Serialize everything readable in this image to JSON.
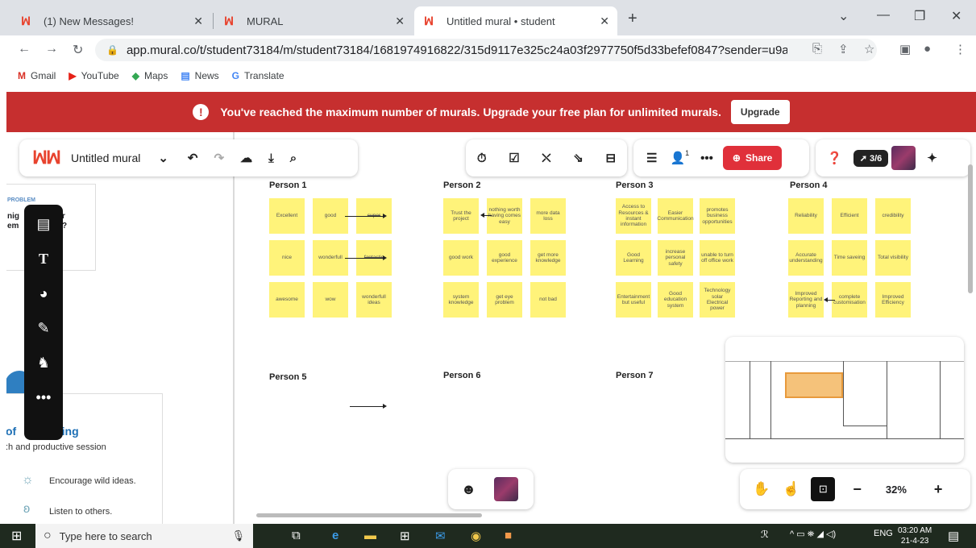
{
  "browser": {
    "tabs": [
      {
        "title": "(1) New Messages!"
      },
      {
        "title": "MURAL"
      },
      {
        "title": "Untitled mural • student"
      }
    ],
    "url": "app.mural.co/t/student73184/m/student73184/1681974916822/315d9117e325c24a03f2977750f5d33befef0847?sender=u9a012a...",
    "bookmarks": [
      "Gmail",
      "YouTube",
      "Maps",
      "News",
      "Translate"
    ]
  },
  "banner": {
    "message": "You've reached the maximum number of murals. Upgrade your free plan for unlimited murals.",
    "button": "Upgrade"
  },
  "mural": {
    "title": "Untitled mural",
    "share_label": "Share",
    "collab_count": "3/6",
    "notification_count": "1",
    "zoom": "32%"
  },
  "left_panel": {
    "problem_label": "PROBLEM",
    "partial_line1": "nig",
    "partial_line2": "em",
    "partial_tail1": "r",
    "partial_tail2": "?",
    "brainstorm_prefix": "of",
    "brainstorm_title": "orming",
    "brainstorm_sub": ":h and productive session",
    "tips": [
      "Encourage wild ideas.",
      "Listen to others."
    ]
  },
  "persons": [
    {
      "name": "Person 1",
      "notes": [
        [
          "Excellent",
          "good",
          "super"
        ],
        [
          "nice",
          "wonderfull",
          "fantastic"
        ],
        [
          "awesome",
          "wow",
          "wonderfull ideas"
        ]
      ]
    },
    {
      "name": "Person 2",
      "notes": [
        [
          "Trust the project",
          "nothing worth having comes easy",
          "more data loss"
        ],
        [
          "good work",
          "good experience",
          "get more knowledge"
        ],
        [
          "system knowledge",
          "get eye problem",
          "not bad"
        ]
      ]
    },
    {
      "name": "Person 3",
      "notes": [
        [
          "Access to Resources & instant information",
          "Easier Communication",
          "promotes business opportunities"
        ],
        [
          "Good Learning",
          "increase personal safety",
          "unable to turn off office work"
        ],
        [
          "Entertainment but useful",
          "Good education system",
          "Technology solar Electrical power"
        ]
      ]
    },
    {
      "name": "Person 4",
      "notes": [
        [
          "Reliability",
          "Efficient",
          "credibility"
        ],
        [
          "Accurate understanding",
          "Time saveing",
          "Total visibility"
        ],
        [
          "Improved Reporting and planning",
          "complete customisation",
          "Improved Efficiency"
        ]
      ]
    },
    {
      "name": "Person 5"
    },
    {
      "name": "Person 6"
    },
    {
      "name": "Person 7"
    }
  ],
  "taskbar": {
    "search_placeholder": "Type here to search",
    "lang": "ENG",
    "time": "03:20 AM",
    "date": "21-4-23"
  }
}
